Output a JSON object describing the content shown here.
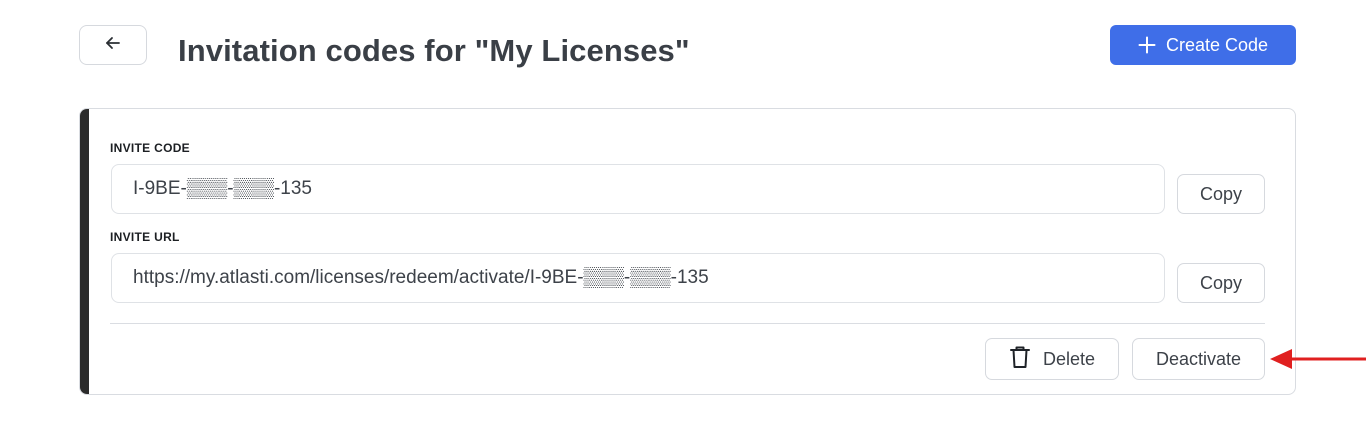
{
  "header": {
    "title": "Invitation codes for \"My Licenses\"",
    "create_button_label": "Create Code",
    "back_icon": "arrow-left-icon",
    "create_icon": "plus-icon"
  },
  "card": {
    "invite_code": {
      "label": "INVITE CODE",
      "value": "I-9BE-▒▒▒-▒▒▒-135",
      "copy_label": "Copy"
    },
    "invite_url": {
      "label": "INVITE URL",
      "value": "https://my.atlasti.com/licenses/redeem/activate/I-9BE-▒▒▒-▒▒▒-135",
      "copy_label": "Copy"
    },
    "actions": {
      "delete_label": "Delete",
      "delete_icon": "trash-icon",
      "deactivate_label": "Deactivate"
    }
  },
  "colors": {
    "primary": "#3f6ee8",
    "accent_bar": "#2b2b2b",
    "annotation_arrow": "#e02020"
  }
}
